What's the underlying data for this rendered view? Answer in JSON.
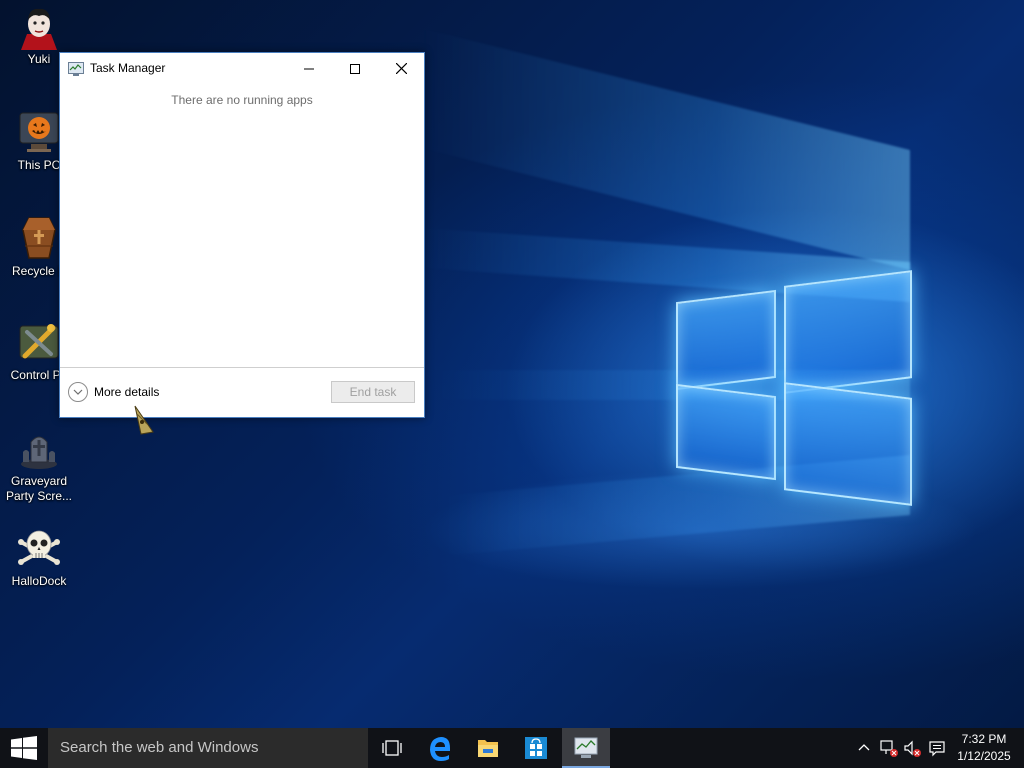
{
  "desktop": {
    "icons": [
      {
        "label": "Yuki",
        "icon": "vampire-avatar-icon"
      },
      {
        "label": "This PC",
        "icon": "pumpkin-computer-icon"
      },
      {
        "label": "Recycle B",
        "icon": "coffin-recycle-bin-icon"
      },
      {
        "label": "Control Pa",
        "icon": "tools-control-panel-icon"
      },
      {
        "label": "Graveyard Party Scre...",
        "icon": "graveyard-screensaver-icon"
      },
      {
        "label": "HalloDock",
        "icon": "skull-crossbones-icon"
      }
    ]
  },
  "task_manager": {
    "title": "Task Manager",
    "empty_message": "There are no running apps",
    "more_details_label": "More details",
    "end_task_label": "End task",
    "end_task_enabled": false
  },
  "taskbar": {
    "search_placeholder": "Search the web and Windows",
    "apps": [
      "task-view-icon",
      "edge-browser-icon",
      "file-explorer-icon",
      "store-icon",
      "task-manager-icon"
    ],
    "active_app": "task-manager-icon",
    "clock_time": "7:32 PM",
    "clock_date": "1/12/2025"
  },
  "colors": {
    "taskbar_bg": "#101217",
    "search_bg": "#2b2b2b",
    "wallpaper_accent": "#3aa0ff"
  }
}
